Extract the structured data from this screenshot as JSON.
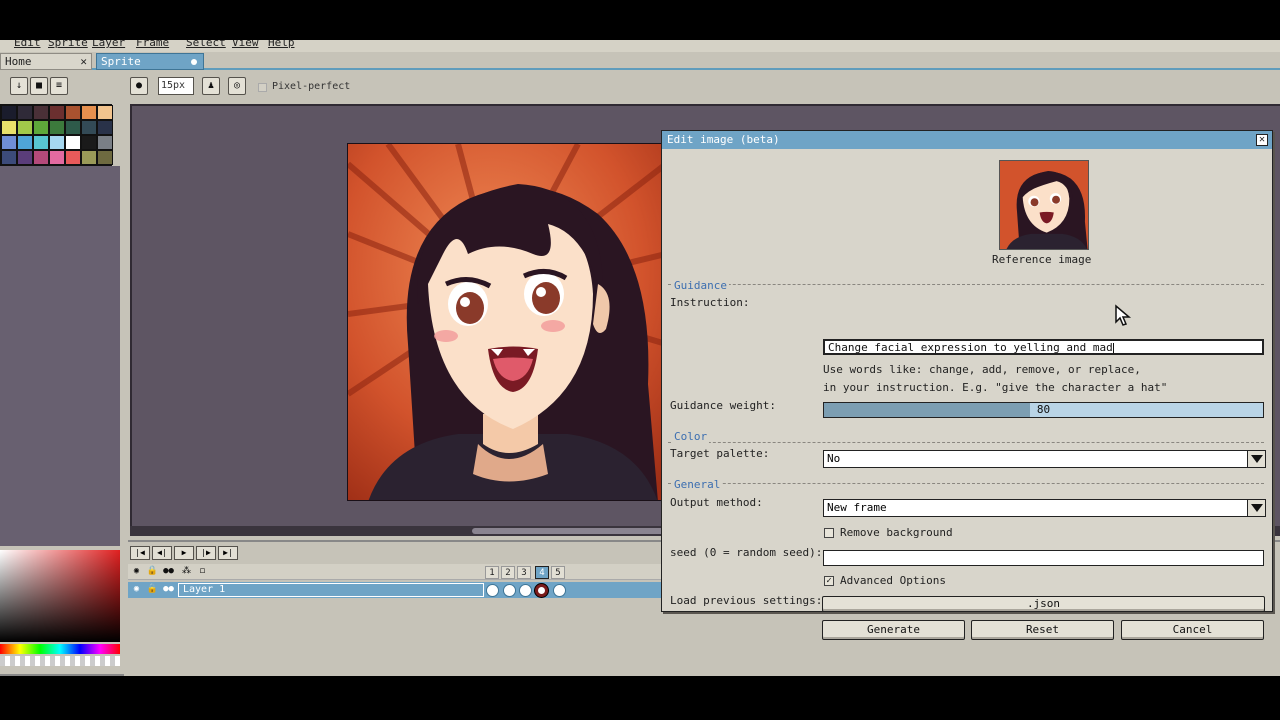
{
  "menu": [
    "Edit",
    "Sprite",
    "Layer",
    "Frame",
    "Select",
    "View",
    "Help"
  ],
  "tabs": {
    "home": "Home",
    "sprite": "Sprite"
  },
  "toolbar": {
    "brush_size": "15px",
    "pixel_perfect": "Pixel-perfect"
  },
  "palette": [
    "#1a1c2c",
    "#2f2a38",
    "#4a3037",
    "#6b2f2f",
    "#a9522f",
    "#e6904e",
    "#f2c48e",
    "#e8e06a",
    "#a2c94a",
    "#5ea83a",
    "#3c7a3c",
    "#2e5a4a",
    "#334a56",
    "#293249",
    "#6f8ed6",
    "#4fa4d8",
    "#58c5d0",
    "#a6d8f0",
    "#ffffff",
    "#1a1a1a",
    "#7a7f86",
    "#3c4b7a",
    "#5a3d7a",
    "#b44a7a",
    "#e36aa0",
    "#e85a5a",
    "#9a9a58",
    "#6e6a40"
  ],
  "timeline": {
    "layer_name": "Layer 1",
    "frames": [
      "1",
      "2",
      "3",
      "4",
      "5"
    ],
    "active_frame": "4"
  },
  "dialog": {
    "title": "Edit image (beta)",
    "reference_label": "Reference image",
    "sections": {
      "guidance": "Guidance",
      "color": "Color",
      "general": "General"
    },
    "instruction_label": "Instruction:",
    "instruction_value": "Change facial expression to yelling and mad",
    "hint_line1": "Use words like: change, add, remove, or replace,",
    "hint_line2": "in your instruction. E.g. \"give the character a hat\"",
    "guidance_weight_label": "Guidance weight:",
    "guidance_weight": "80",
    "guidance_weight_fraction": 0.47,
    "target_palette_label": "Target palette:",
    "target_palette_value": "No",
    "output_method_label": "Output method:",
    "output_method_value": "New frame",
    "remove_background_label": "Remove background",
    "remove_background_checked": false,
    "seed_label": "seed (0 = random seed):",
    "seed_value": "",
    "advanced_label": "Advanced Options",
    "advanced_checked": true,
    "load_label": "Load previous settings:",
    "load_button": ".json",
    "generate": "Generate",
    "reset": "Reset",
    "cancel": "Cancel"
  },
  "colors": {
    "accent": "#6fa4c6",
    "canvas_bg": "#5e5563",
    "sprite_bg": "#c2401e",
    "dialog_bg": "#d8d5cb"
  }
}
